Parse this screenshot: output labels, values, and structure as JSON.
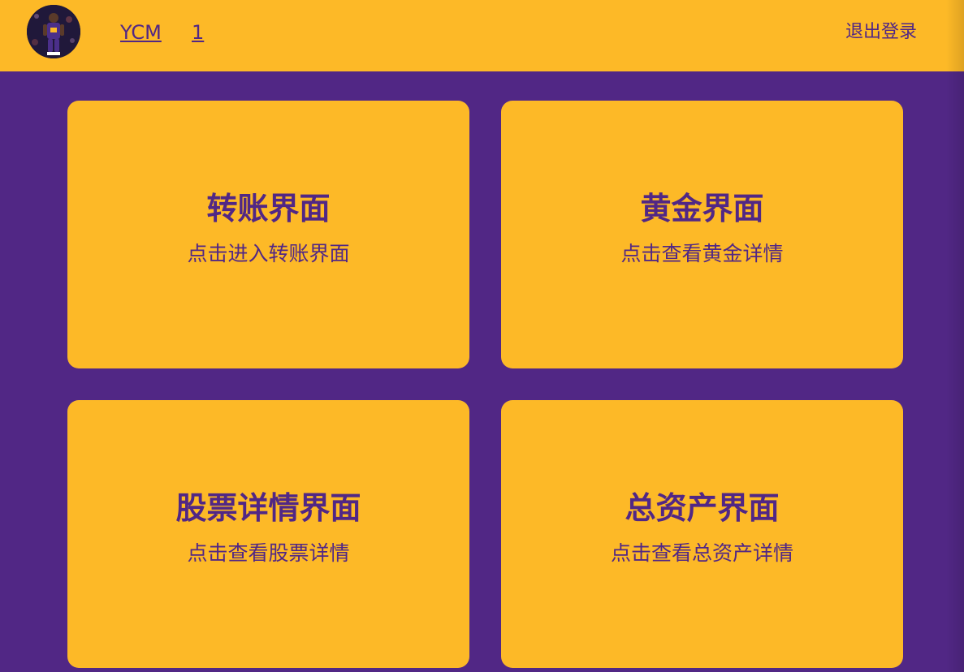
{
  "header": {
    "username": "YCM",
    "user_id": "1",
    "logout_label": "退出登录",
    "avatar_icon": "user-avatar-photo"
  },
  "cards": [
    {
      "title": "转账界面",
      "description": "点击进入转账界面"
    },
    {
      "title": "黄金界面",
      "description": "点击查看黄金详情"
    },
    {
      "title": "股票详情界面",
      "description": "点击查看股票详情"
    },
    {
      "title": "总资产界面",
      "description": "点击查看总资产详情"
    }
  ],
  "colors": {
    "background": "#512785",
    "accent": "#fdb927",
    "text": "#512785"
  }
}
